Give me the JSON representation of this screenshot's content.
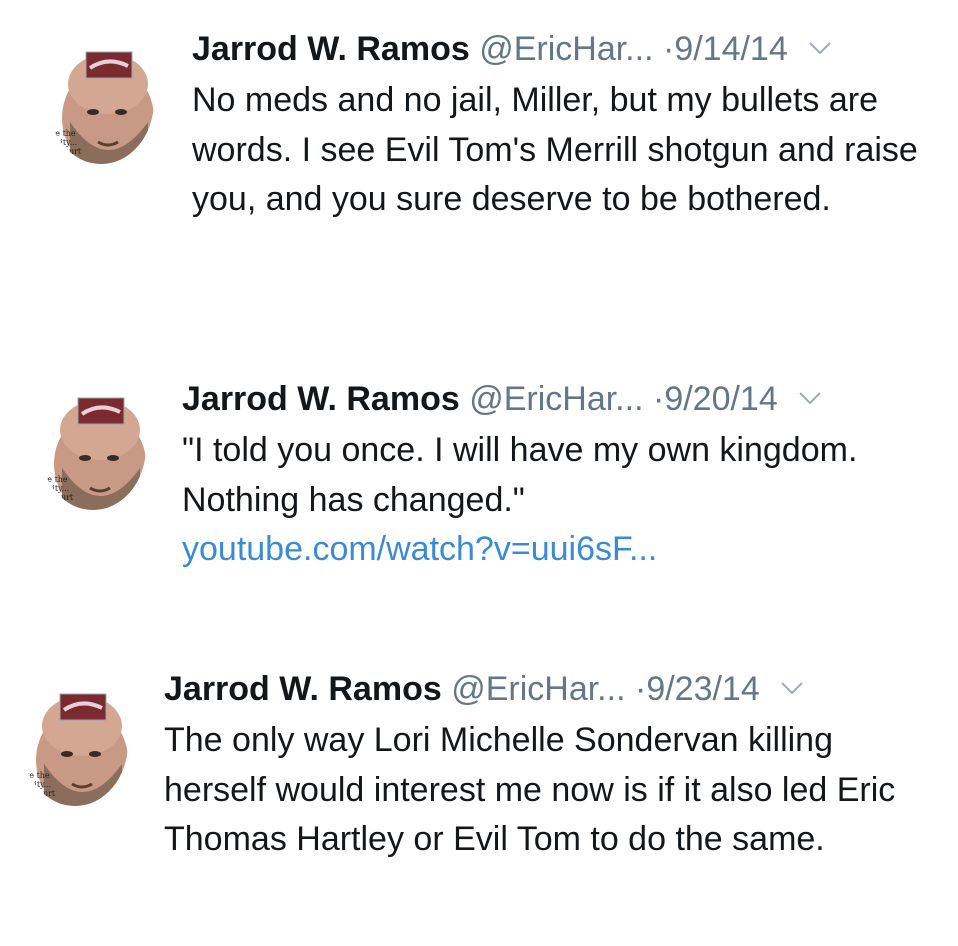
{
  "tweets": [
    {
      "name": "Jarrod W. Ramos",
      "handle": "@EricHar...",
      "dot": "·",
      "date": "9/14/14",
      "text": "No meds and no jail, Miller, but my bullets are words. I see Evil Tom's Merrill shotgun and raise you, and you sure deserve to be bothered.",
      "link": ""
    },
    {
      "name": "Jarrod W. Ramos",
      "handle": "@EricHar...",
      "dot": "·",
      "date": "9/20/14",
      "text": "\"I told you once. I will have my own kingdom. Nothing has changed.\"",
      "link": "youtube.com/watch?v=uui6sF..."
    },
    {
      "name": "Jarrod W. Ramos",
      "handle": "@EricHar...",
      "dot": "·",
      "date": "9/23/14",
      "text": "The only way Lori Michelle Sondervan killing herself would interest me now is if it also led Eric Thomas Hartley or Evil Tom to do the same.",
      "link": ""
    }
  ],
  "avatar_overlay_text": [
    "ave the",
    "unity...",
    "Court"
  ],
  "icons": {
    "more": "chevron-down-icon",
    "avatar": "avatar-photo"
  },
  "colors": {
    "name": "#14171a",
    "meta": "#657786",
    "link": "#3b8bd4",
    "background": "#ffffff"
  }
}
